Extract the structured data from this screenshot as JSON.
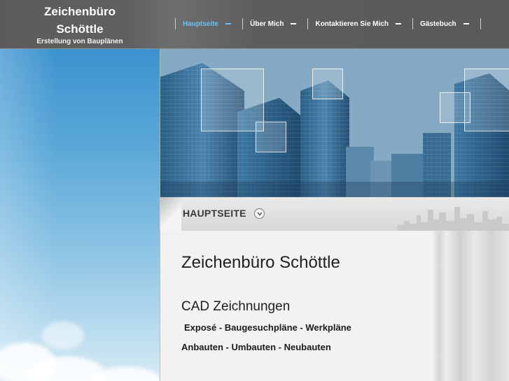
{
  "brand": {
    "title_line1": "Zeichenbüro",
    "title_line2": "Schöttle",
    "subtitle": "Erstellung von Bauplänen"
  },
  "nav": {
    "items": [
      {
        "label": "Hauptseite",
        "active": true
      },
      {
        "label": "Über Mich",
        "active": false
      },
      {
        "label": "Kontaktieren Sie Mich",
        "active": false
      },
      {
        "label": "Gästebuch",
        "active": false
      }
    ]
  },
  "page": {
    "section_title": "HAUPTSEITE"
  },
  "content": {
    "heading": "Zeichenbüro Schöttle",
    "subheading": "CAD Zeichnungen",
    "line1": "Exposé - Baugesuchpläne - Werkpläne",
    "line2": "Anbauten - Umbauten - Neubauten"
  },
  "colors": {
    "active_nav": "#6ac3f0",
    "header_bg": "#5b5b5b",
    "sky": "#3d93cf"
  },
  "icons": {
    "title_toggle": "chevron-down-icon"
  }
}
